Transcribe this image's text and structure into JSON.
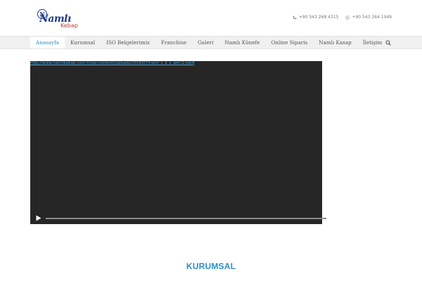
{
  "brand": {
    "name": "Namlı",
    "sub": "Kebap",
    "emblem": "N"
  },
  "contacts": [
    {
      "icon": "phone-icon",
      "text": "+90 543 268 4315"
    },
    {
      "icon": "whatsapp-icon",
      "text": "+90 543 264 1049"
    }
  ],
  "nav": {
    "items": [
      {
        "label": "Anasayfa",
        "active": true
      },
      {
        "label": "Kurumsal",
        "active": false
      },
      {
        "label": "ISO Belgelerimiz",
        "active": false
      },
      {
        "label": "Franchise",
        "active": false
      },
      {
        "label": "Galeri",
        "active": false
      },
      {
        "label": "Namlı Künefe",
        "active": false
      },
      {
        "label": "Online Siparis",
        "active": false
      },
      {
        "label": "Namlı Kasap",
        "active": false
      },
      {
        "label": "İletişim",
        "active": false
      }
    ],
    "search_icon": "search-icon"
  },
  "video": {
    "url": "http://www.namlikebap.com.tr/wp-content/uploads/2016/07/naml_c_k_s_wm-2.mp4",
    "progress": 0,
    "controls": [
      "play-icon",
      "volume-icon",
      "fullscreen-icon"
    ]
  },
  "section": {
    "title": "KURUMSAL"
  },
  "colors": {
    "accent": "#2a8fc8",
    "navbar_bg": "#f0f0f0",
    "video_bg": "#262626",
    "brand_blue": "#1e3a8a",
    "brand_red": "#c0392b"
  }
}
